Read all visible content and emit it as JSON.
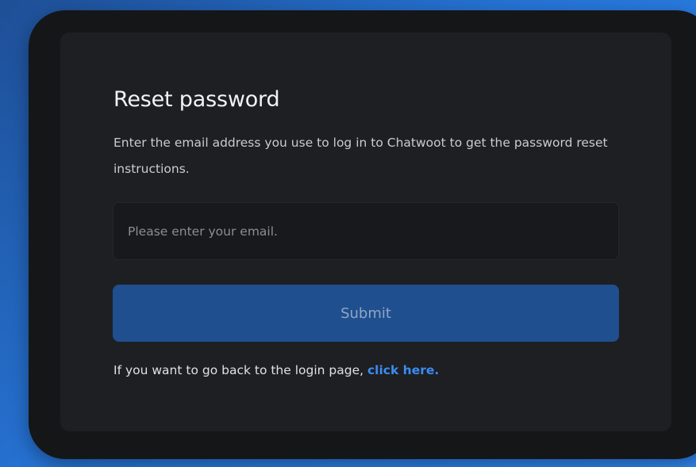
{
  "reset": {
    "title": "Reset password",
    "description": "Enter the email address you use to log in to Chatwoot to get the password reset instructions.",
    "email_placeholder": "Please enter your email.",
    "email_value": "",
    "submit_label": "Submit",
    "back_prefix": "If you want to go back to the login page, ",
    "back_link": "click here."
  },
  "colors": {
    "accent": "#3b8cf0",
    "button": "#1f4f8f",
    "card": "#1e1f23",
    "frame": "#151618"
  }
}
